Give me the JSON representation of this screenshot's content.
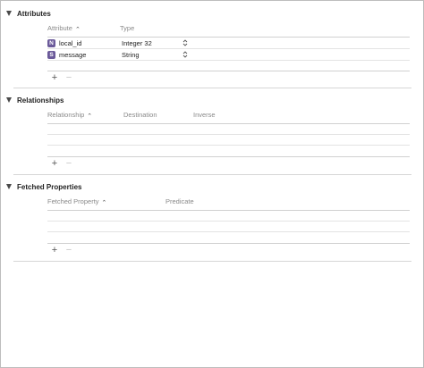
{
  "attributes": {
    "title": "Attributes",
    "columns": {
      "attribute": "Attribute",
      "type": "Type"
    },
    "rows": [
      {
        "badge": "N",
        "name": "local_id",
        "type": "Integer 32"
      },
      {
        "badge": "S",
        "name": "message",
        "type": "String"
      }
    ],
    "add_label": "+",
    "remove_label": "−"
  },
  "relationships": {
    "title": "Relationships",
    "columns": {
      "relationship": "Relationship",
      "destination": "Destination",
      "inverse": "Inverse"
    },
    "add_label": "+",
    "remove_label": "−"
  },
  "fetched_properties": {
    "title": "Fetched Properties",
    "columns": {
      "fetched_property": "Fetched Property",
      "predicate": "Predicate"
    },
    "add_label": "+",
    "remove_label": "−"
  },
  "icons": {
    "sort_ascending": "chevron-up-icon",
    "disclosure": "disclosure-triangle-icon",
    "stepper": "up-down-stepper-icon"
  }
}
